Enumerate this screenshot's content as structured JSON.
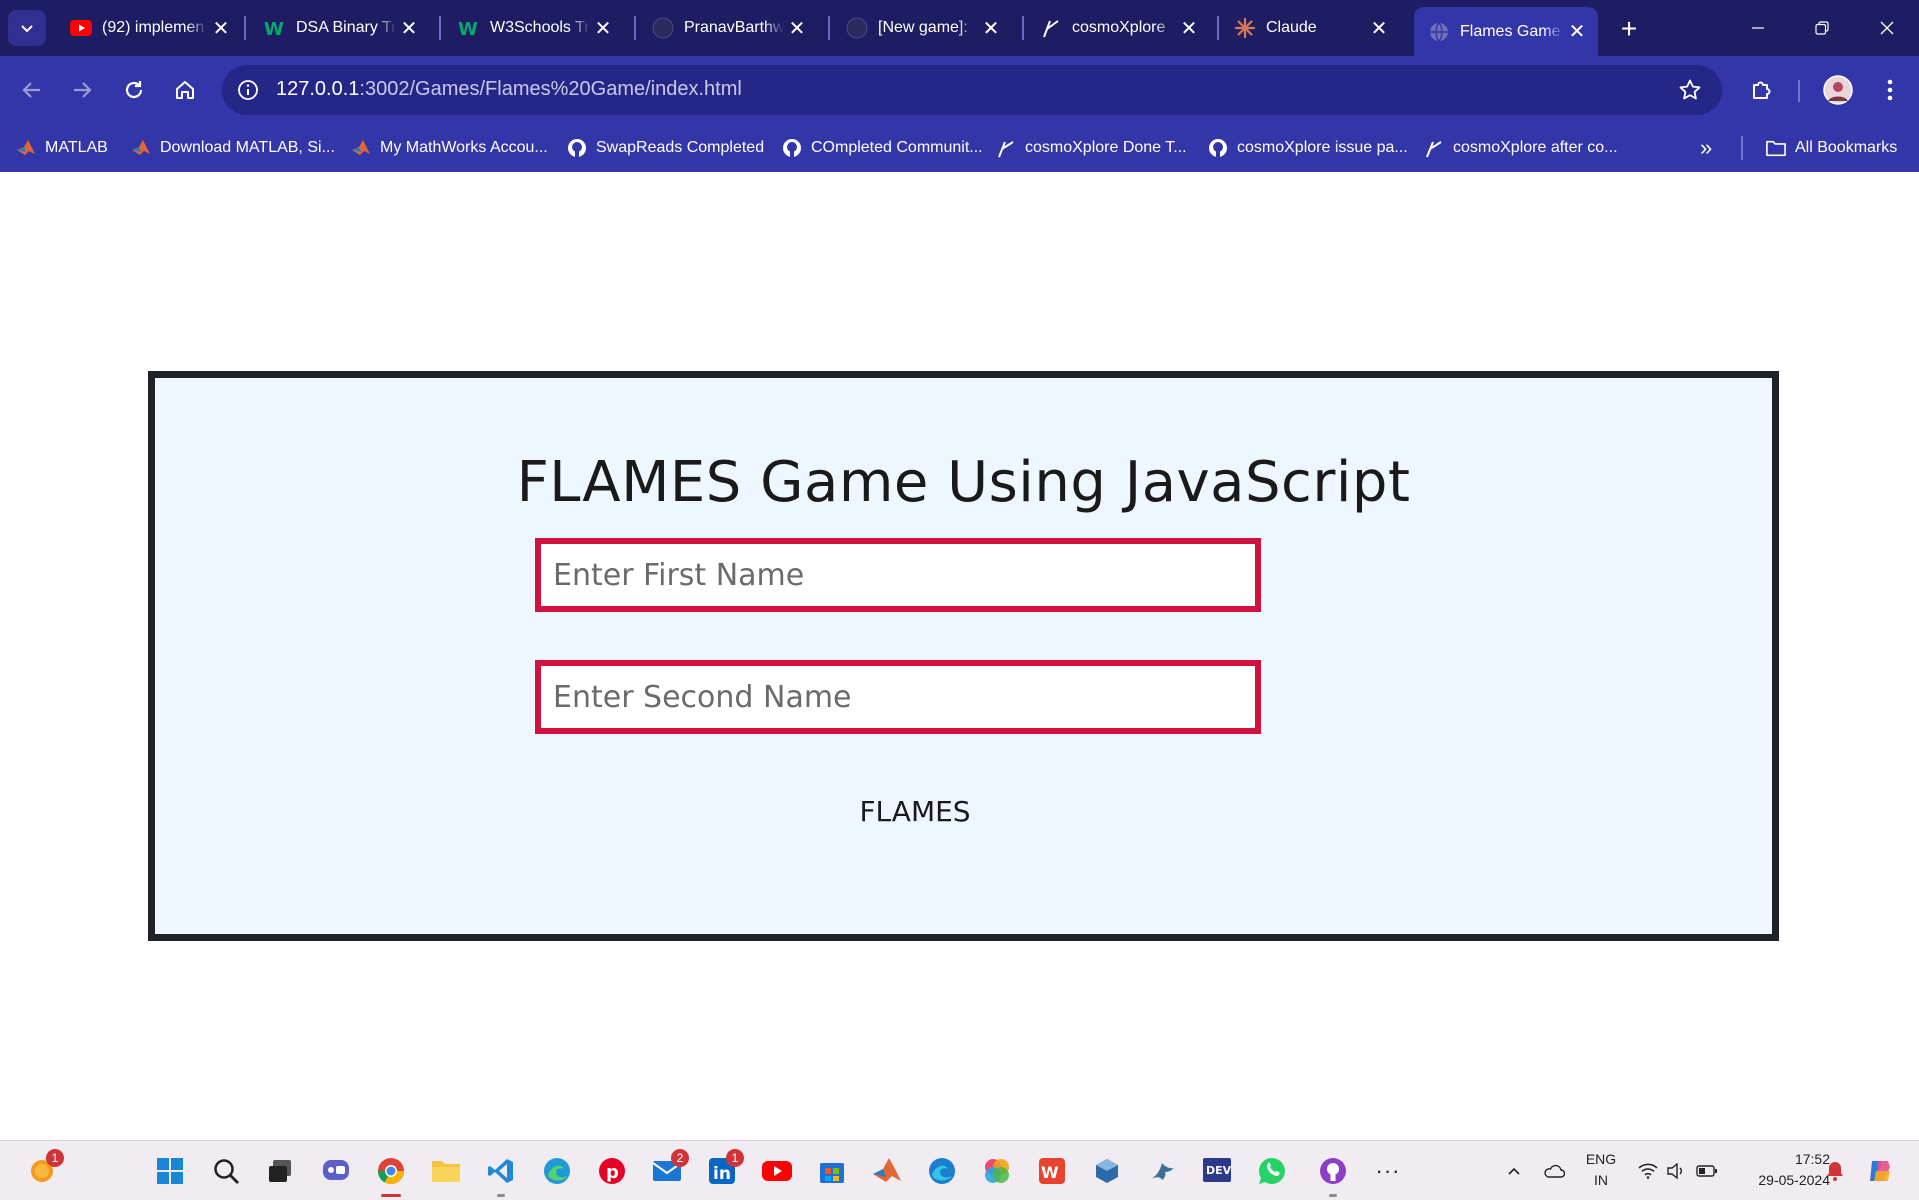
{
  "tabs": [
    {
      "label": "(92) implemen",
      "favicon": "youtube-icon"
    },
    {
      "label": "DSA Binary Tr",
      "favicon": "w3schools-icon"
    },
    {
      "label": "W3Schools Tr",
      "favicon": "w3schools-icon"
    },
    {
      "label": "PranavBarthw",
      "favicon": "github-icon"
    },
    {
      "label": "[New game]:",
      "favicon": "github-icon"
    },
    {
      "label": "cosmoXplore",
      "favicon": "cosmoxplore-icon"
    },
    {
      "label": "Claude",
      "favicon": "claude-icon"
    },
    {
      "label": "Flames Game",
      "favicon": "globe-icon",
      "active": true
    }
  ],
  "address": {
    "host": "127.0.0.1",
    "path": ":3002/Games/Flames%20Game/index.html"
  },
  "bookmarks": [
    {
      "label": "MATLAB",
      "icon": "matlab-icon"
    },
    {
      "label": "Download MATLAB, Si...",
      "icon": "matlab-icon"
    },
    {
      "label": "My MathWorks Accou...",
      "icon": "matlab-icon"
    },
    {
      "label": "SwapReads Completed",
      "icon": "github-icon"
    },
    {
      "label": "COmpleted Communit...",
      "icon": "github-icon"
    },
    {
      "label": "cosmoXplore Done T...",
      "icon": "cosmoxplore-icon"
    },
    {
      "label": "cosmoXplore issue pa...",
      "icon": "github-icon"
    },
    {
      "label": "cosmoXplore after co...",
      "icon": "cosmoxplore-icon"
    }
  ],
  "all_bookmarks_label": "All Bookmarks",
  "game": {
    "title": "FLAMES Game Using JavaScript",
    "first_placeholder": "Enter First Name",
    "second_placeholder": "Enter Second Name",
    "first_value": "",
    "second_value": "",
    "button_label": "FLAMES"
  },
  "taskbar": {
    "notification_badge": "1",
    "mail_badge": "2",
    "linkedin_badge": "1",
    "lang_top": "ENG",
    "lang_bottom": "IN",
    "time": "17:52",
    "date": "29-05-2024"
  },
  "colors": {
    "tab_strip": "#1e1c63",
    "toolbar": "#3336a8",
    "game_background": "#eef6ff",
    "input_border": "#d1123f",
    "box_border": "#1f2228"
  }
}
